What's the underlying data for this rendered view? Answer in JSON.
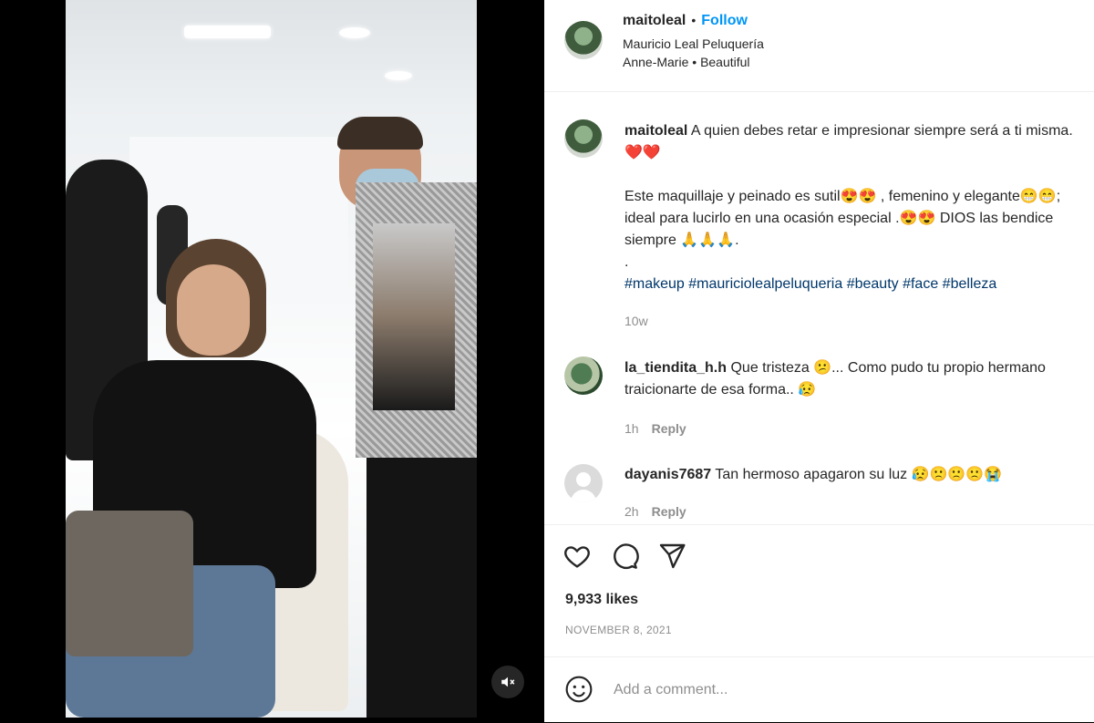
{
  "post": {
    "username": "maitoleal",
    "follow_label": "Follow",
    "location": "Mauricio Leal Peluquería",
    "music_artist": "Anne-Marie",
    "music_title": "Beautiful"
  },
  "caption": {
    "username": "maitoleal",
    "line1": "A quien debes retar e impresionar siempre será a ti misma. ❤️❤️",
    "line2": "Este maquillaje y peinado es sutil😍😍 , femenino y elegante😁😁; ideal para lucirlo en una ocasión especial .😍😍 DIOS las bendice siempre 🙏🙏🙏.",
    "line3": ".",
    "hashtags": "#makeup #mauriciolealpeluqueria #beauty #face #belleza",
    "time": "10w"
  },
  "comments": [
    {
      "username": "la_tiendita_h.h",
      "text": "Que tristeza 😕... Como pudo tu propio hermano traicionarte de esa forma.. 😥",
      "time": "1h",
      "reply_label": "Reply"
    },
    {
      "username": "dayanis7687",
      "text": "Tan hermoso apagaron su luz 😥🙁🙁🙁😭",
      "time": "2h",
      "reply_label": "Reply"
    }
  ],
  "footer": {
    "likes": "9,933 likes",
    "date": "NOVEMBER 8, 2021",
    "comment_placeholder": "Add a comment..."
  },
  "icons": {
    "like": "heart-icon",
    "comment": "comment-bubble-icon",
    "share": "paper-plane-icon",
    "emoji": "smiley-icon",
    "mute": "speaker-muted-icon"
  }
}
